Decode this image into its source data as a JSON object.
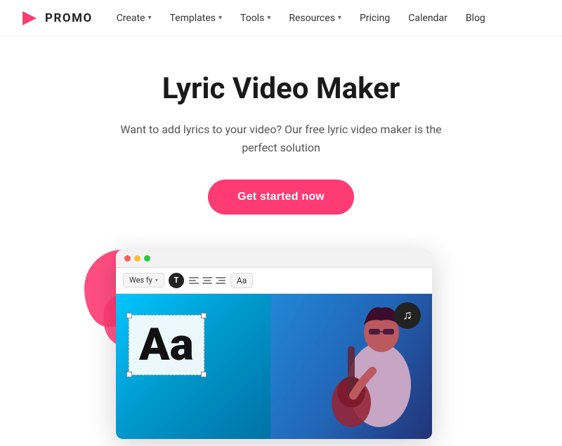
{
  "brand": {
    "logo_text": "PROMO",
    "logo_icon_color": "#ff3b73"
  },
  "nav": {
    "items": [
      {
        "id": "create",
        "label": "Create",
        "has_dropdown": true
      },
      {
        "id": "templates",
        "label": "Templates",
        "has_dropdown": true
      },
      {
        "id": "tools",
        "label": "Tools",
        "has_dropdown": true
      },
      {
        "id": "resources",
        "label": "Resources",
        "has_dropdown": true
      },
      {
        "id": "pricing",
        "label": "Pricing",
        "has_dropdown": false
      },
      {
        "id": "calendar",
        "label": "Calendar",
        "has_dropdown": false
      },
      {
        "id": "blog",
        "label": "Blog",
        "has_dropdown": false
      }
    ]
  },
  "hero": {
    "title": "Lyric Video Maker",
    "subtitle": "Want to add lyrics to your video? Our free lyric video maker is the perfect solution",
    "cta_label": "Get started now"
  },
  "editor": {
    "font_name": "Wes fy",
    "aa_label": "Aa",
    "text_sample": "Aa",
    "music_icon": "♫",
    "window_dots": [
      "red",
      "yellow",
      "green"
    ]
  }
}
